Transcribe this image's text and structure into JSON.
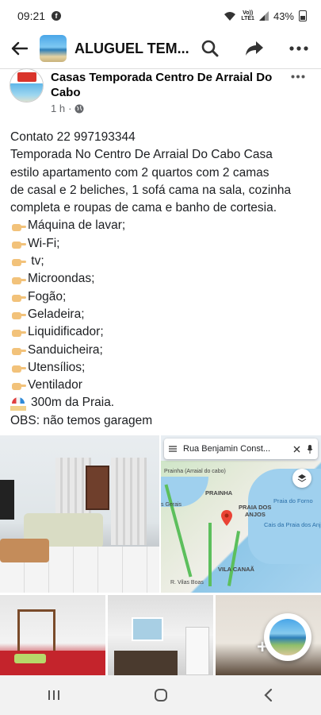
{
  "status_bar": {
    "time": "09:21",
    "network_top": "Vo))",
    "network_bottom": "LTE1",
    "battery": "43%"
  },
  "header": {
    "group_title": "ALUGUEL TEM..."
  },
  "post": {
    "author": "Casas Temporada Centro De Arraial Do Cabo",
    "time": "1 h",
    "intro": [
      "Contato 22 997193344",
      "Temporada No Centro De Arraial Do Cabo Casa",
      "estilo apartamento com 2 quartos com 2 camas",
      "de casal e 2 beliches, 1 sofá cama na sala, cozinha",
      "completa e roupas de cama e banho de cortesia."
    ],
    "amenities": [
      "Máquina de lavar;",
      "Wi-Fi;",
      " tv;",
      "Microondas;",
      "Fogão;",
      "Geladeira;",
      "Liquidificador;",
      "Sanduicheira;",
      "Utensílios;",
      "Ventilador"
    ],
    "distance": "300m da Praia.",
    "note": "OBS: não temos garagem"
  },
  "map": {
    "search_text": "Rua Benjamin Const...",
    "labels": {
      "prainha": "PRAINHA",
      "praia_dos_anjos_1": "PRAIA DOS",
      "praia_dos_anjos_2": "ANJOS",
      "vila_canaa": "VILA CANAÃ",
      "praia_arraial": "Prainha (Arraial do cabo)",
      "praia_forno": "Praia do Forno",
      "cais": "Cais da Praia dos Anjos",
      "geral": "s Gerais",
      "vilas_boas": "R. Vilas Boas"
    }
  },
  "photos": {
    "more_label": "+"
  },
  "colors": {
    "accent": "#1877f2",
    "map_pin": "#ea4335",
    "route": "#5cbf5c",
    "bed_red": "#c4242c"
  }
}
